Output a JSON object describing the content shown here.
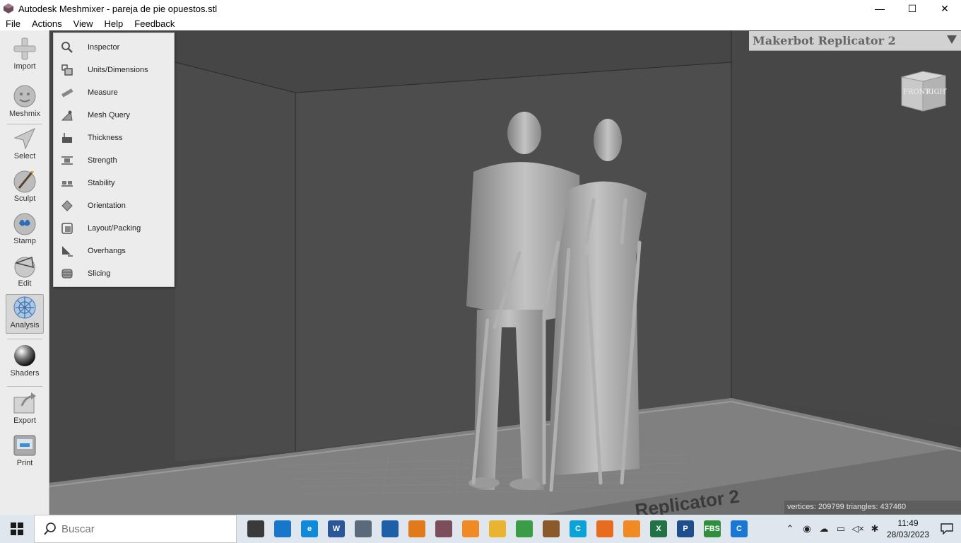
{
  "window": {
    "title": "Autodesk Meshmixer - pareja de pie opuestos.stl",
    "minimize": "—",
    "maximize": "☐",
    "close": "✕"
  },
  "menubar": [
    "File",
    "Actions",
    "View",
    "Help",
    "Feedback"
  ],
  "toolbar": [
    {
      "label": "Import",
      "icon": "import-icon"
    },
    {
      "label": "Meshmix",
      "icon": "meshmix-icon"
    },
    {
      "label": "Select",
      "icon": "select-icon"
    },
    {
      "label": "Sculpt",
      "icon": "sculpt-icon"
    },
    {
      "label": "Stamp",
      "icon": "stamp-icon"
    },
    {
      "label": "Edit",
      "icon": "edit-icon"
    },
    {
      "label": "Analysis",
      "icon": "analysis-icon"
    },
    {
      "label": "Shaders",
      "icon": "shaders-icon"
    },
    {
      "label": "Export",
      "icon": "export-icon"
    },
    {
      "label": "Print",
      "icon": "print-icon"
    }
  ],
  "analysis_menu": [
    {
      "label": "Inspector",
      "icon": "magnifier-icon"
    },
    {
      "label": "Units/Dimensions",
      "icon": "units-icon"
    },
    {
      "label": "Measure",
      "icon": "ruler-icon"
    },
    {
      "label": "Mesh Query",
      "icon": "mesh-query-icon"
    },
    {
      "label": "Thickness",
      "icon": "thickness-icon"
    },
    {
      "label": "Strength",
      "icon": "strength-icon"
    },
    {
      "label": "Stability",
      "icon": "stability-icon"
    },
    {
      "label": "Orientation",
      "icon": "orientation-icon"
    },
    {
      "label": "Layout/Packing",
      "icon": "layout-icon"
    },
    {
      "label": "Overhangs",
      "icon": "overhangs-icon"
    },
    {
      "label": "Slicing",
      "icon": "slicing-icon"
    }
  ],
  "printer": {
    "name": "Makerbot Replicator 2"
  },
  "viewcube": {
    "front": "FRONT",
    "right": "RIGHT"
  },
  "status": "vertices: 209799 triangles: 437460",
  "taskbar": {
    "search_placeholder": "Buscar",
    "apps": [
      {
        "name": "task-view",
        "color": "#3a3a3a",
        "text": ""
      },
      {
        "name": "app-blue-3d",
        "color": "#1877c9",
        "text": ""
      },
      {
        "name": "edge",
        "color": "#0f8ad8",
        "text": "e"
      },
      {
        "name": "word",
        "color": "#2b579a",
        "text": "W"
      },
      {
        "name": "calculator",
        "color": "#5a6a7a",
        "text": ""
      },
      {
        "name": "app-window",
        "color": "#1e5fa8",
        "text": ""
      },
      {
        "name": "app-orange-box",
        "color": "#e07a1a",
        "text": ""
      },
      {
        "name": "meshmixer",
        "color": "#7c4d5b",
        "text": ""
      },
      {
        "name": "blender",
        "color": "#f08a24",
        "text": ""
      },
      {
        "name": "explorer",
        "color": "#e9b531",
        "text": ""
      },
      {
        "name": "chrome",
        "color": "#3a9c46",
        "text": ""
      },
      {
        "name": "app-figure",
        "color": "#8b5a2b",
        "text": ""
      },
      {
        "name": "app-c-cyan",
        "color": "#0aa3d9",
        "text": "C"
      },
      {
        "name": "app-orange-frame",
        "color": "#e86c1f",
        "text": ""
      },
      {
        "name": "blender-2",
        "color": "#f08a24",
        "text": ""
      },
      {
        "name": "excel",
        "color": "#217346",
        "text": "X"
      },
      {
        "name": "app-p",
        "color": "#1f4e8c",
        "text": "P"
      },
      {
        "name": "app-fbs",
        "color": "#2f8f3c",
        "text": "FBS"
      },
      {
        "name": "app-c-blue",
        "color": "#1878d4",
        "text": "C"
      }
    ],
    "time": "11:49",
    "date": "28/03/2023"
  }
}
